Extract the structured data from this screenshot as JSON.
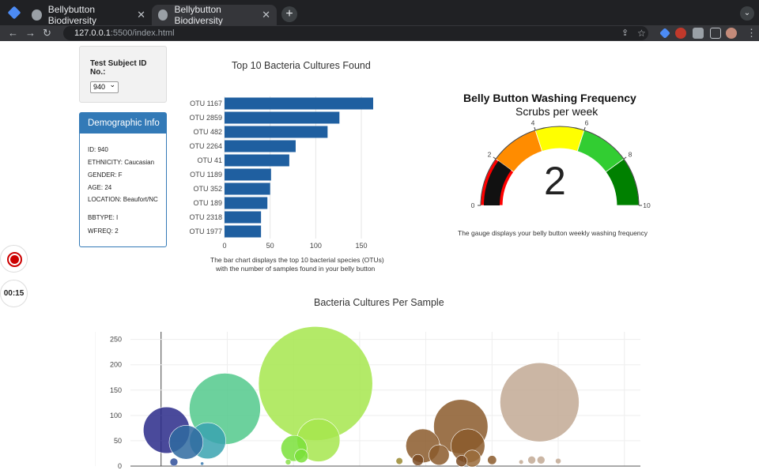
{
  "browser": {
    "tabs": [
      {
        "title": "Bellybutton Biodiversity",
        "active": false
      },
      {
        "title": "Bellybutton Biodiversity",
        "active": true
      }
    ],
    "url_host": "127.0.0.1",
    "url_rest": ":5500/index.html"
  },
  "selector": {
    "label": "Test Subject ID No.:",
    "value": "940"
  },
  "demographic": {
    "title": "Demographic Info",
    "rows": [
      "ID: 940",
      "ETHNICITY: Caucasian",
      "GENDER: F",
      "AGE: 24",
      "LOCATION: Beaufort/NC",
      "BBTYPE: I",
      "WFREQ: 2"
    ]
  },
  "recorder": {
    "timer": "00:15"
  },
  "bar_chart": {
    "title": "Top 10 Bacteria Cultures Found",
    "caption_line1": "The bar chart displays the top 10 bacterial species (OTUs)",
    "caption_line2": "with the number of samples found in your belly button",
    "color": "#1f5fa0"
  },
  "gauge": {
    "title": "Belly Button Washing Frequency",
    "subtitle": "Scrubs per week",
    "value": "2",
    "caption": "The gauge displays your belly button weekly washing frequency"
  },
  "bubble": {
    "title": "Bacteria Cultures Per Sample"
  },
  "chart_data": [
    {
      "type": "bar",
      "title": "Top 10 Bacteria Cultures Found",
      "orientation": "horizontal",
      "categories": [
        "OTU 1167",
        "OTU 2859",
        "OTU 482",
        "OTU 2264",
        "OTU 41",
        "OTU 1189",
        "OTU 352",
        "OTU 189",
        "OTU 2318",
        "OTU 1977"
      ],
      "values": [
        163,
        126,
        113,
        78,
        71,
        51,
        50,
        47,
        40,
        40
      ],
      "xlim": [
        0,
        163
      ],
      "xticks": [
        0,
        50,
        100,
        150
      ],
      "color": "#1f5fa0"
    },
    {
      "type": "gauge",
      "title": "Belly Button Washing Frequency",
      "subtitle": "Scrubs per week",
      "value": 2,
      "range": [
        0,
        10
      ],
      "ticks": [
        0,
        2,
        4,
        6,
        8,
        10
      ],
      "bands": [
        {
          "from": 0,
          "to": 2,
          "color": "#ff0000"
        },
        {
          "from": 2,
          "to": 4,
          "color": "#ff8c00"
        },
        {
          "from": 4,
          "to": 6,
          "color": "#ffff00"
        },
        {
          "from": 6,
          "to": 8,
          "color": "#32cd32"
        },
        {
          "from": 8,
          "to": 10,
          "color": "#008000"
        }
      ]
    },
    {
      "type": "scatter",
      "title": "Bacteria Cultures Per Sample",
      "ylim": [
        0,
        265
      ],
      "yticks": [
        0,
        50,
        100,
        150,
        200,
        250
      ],
      "xlim": [
        -500,
        3800
      ],
      "grid": true,
      "points": [
        {
          "x": 41,
          "y": 71,
          "r": 41,
          "color": "#2a2a8a"
        },
        {
          "x": 189,
          "y": 47,
          "r": 30,
          "color": "#2f6aa0"
        },
        {
          "x": 352,
          "y": 50,
          "r": 32,
          "color": "#3aa3b0"
        },
        {
          "x": 97,
          "y": 8,
          "r": 7,
          "color": "#2f4f9a"
        },
        {
          "x": 310,
          "y": 5,
          "r": 3,
          "color": "#3a7ab0"
        },
        {
          "x": 482,
          "y": 113,
          "r": 63,
          "color": "#52c98c"
        },
        {
          "x": 1167,
          "y": 163,
          "r": 101,
          "color": "#a6e64e"
        },
        {
          "x": 1189,
          "y": 51,
          "r": 38,
          "color": "#a6e64e"
        },
        {
          "x": 1004,
          "y": 35,
          "r": 23,
          "color": "#7ae03a"
        },
        {
          "x": 1060,
          "y": 20,
          "r": 12,
          "color": "#7ae03a"
        },
        {
          "x": 960,
          "y": 8,
          "r": 5,
          "color": "#8ae04a"
        },
        {
          "x": 2264,
          "y": 78,
          "r": 48,
          "color": "#8b5a2b"
        },
        {
          "x": 1977,
          "y": 40,
          "r": 30,
          "color": "#8b5a2b"
        },
        {
          "x": 2318,
          "y": 40,
          "r": 30,
          "color": "#8b5a2b"
        },
        {
          "x": 2100,
          "y": 22,
          "r": 18,
          "color": "#8b5a2b"
        },
        {
          "x": 2350,
          "y": 15,
          "r": 15,
          "color": "#9a6b3a"
        },
        {
          "x": 2270,
          "y": 10,
          "r": 10,
          "color": "#7a4a22"
        },
        {
          "x": 1940,
          "y": 12,
          "r": 10,
          "color": "#7a4a22"
        },
        {
          "x": 1800,
          "y": 10,
          "r": 6,
          "color": "#9a8a30"
        },
        {
          "x": 2500,
          "y": 12,
          "r": 8,
          "color": "#8b5a2b"
        },
        {
          "x": 2859,
          "y": 126,
          "r": 70,
          "color": "#c2a994"
        },
        {
          "x": 2800,
          "y": 12,
          "r": 7,
          "color": "#c2a994"
        },
        {
          "x": 2870,
          "y": 12,
          "r": 7,
          "color": "#c2a994"
        },
        {
          "x": 3000,
          "y": 10,
          "r": 5,
          "color": "#c2a994"
        },
        {
          "x": 2720,
          "y": 8,
          "r": 4,
          "color": "#c2a994"
        }
      ]
    }
  ]
}
